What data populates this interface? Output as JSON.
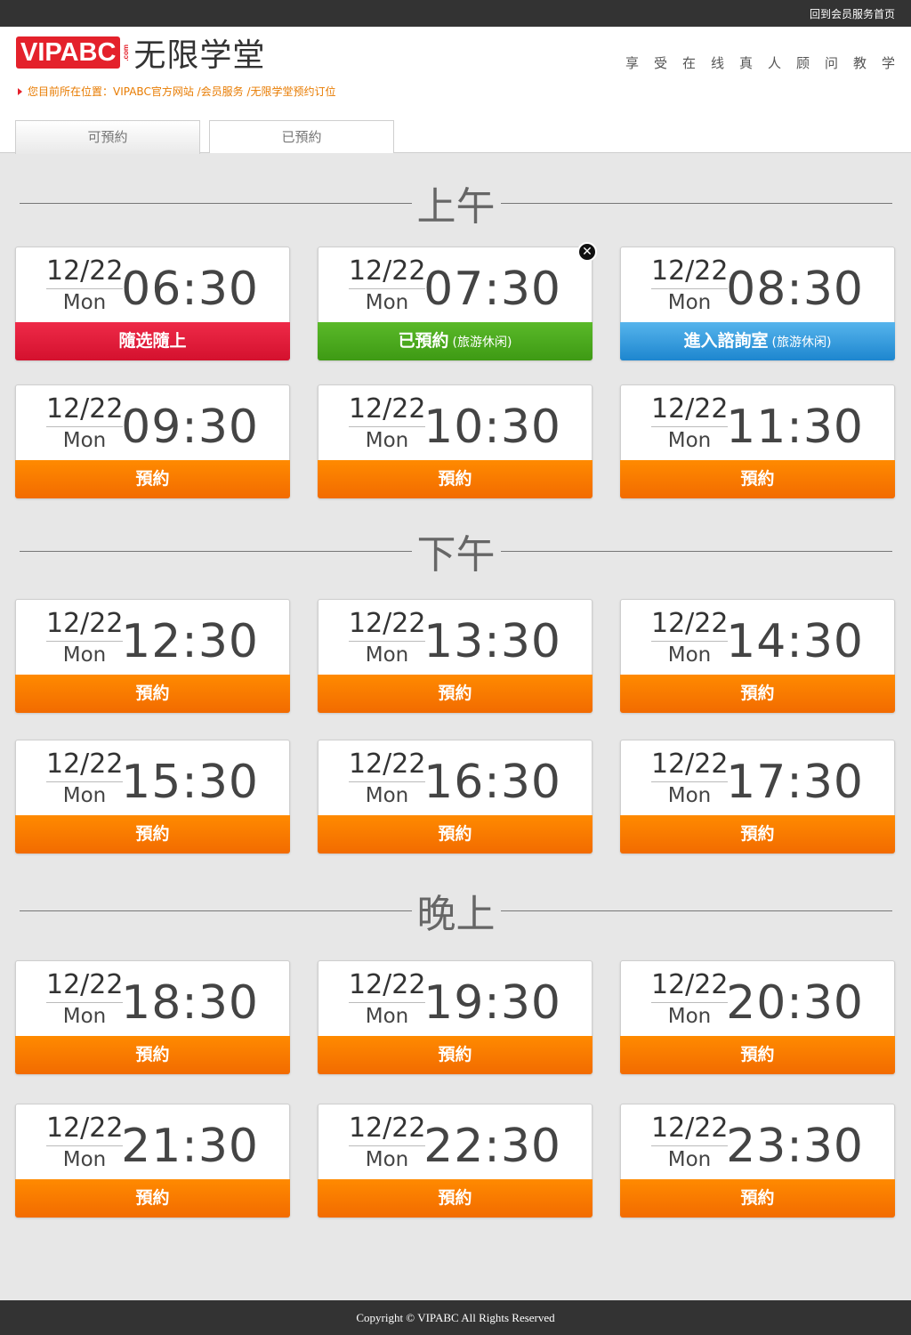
{
  "topbar": {
    "home_link": "回到会员服务首页"
  },
  "header": {
    "logo_main": "VIPABC",
    "logo_com": ".com",
    "logo_text": "无限学堂",
    "slogan": "享受在线真人顾问教学",
    "breadcrumb": "您目前所在位置：VIPABC官方网站 /会员服务 /无限学堂预约订位"
  },
  "tabs": [
    {
      "label": "可預約"
    },
    {
      "label": "已預約"
    }
  ],
  "sections": [
    {
      "label": "上午"
    },
    {
      "label": "下午"
    },
    {
      "label": "晚上"
    }
  ],
  "slots": [
    {
      "date": "12/22",
      "weekday": "Mon",
      "time": "06:30",
      "action": "隨选隨上",
      "note": "",
      "style": "red"
    },
    {
      "date": "12/22",
      "weekday": "Mon",
      "time": "07:30",
      "action": "已預約",
      "note": "(旅游休闲)",
      "style": "green"
    },
    {
      "date": "12/22",
      "weekday": "Mon",
      "time": "08:30",
      "action": "進入諮詢室",
      "note": "(旅游休闲)",
      "style": "blue"
    },
    {
      "date": "12/22",
      "weekday": "Mon",
      "time": "09:30",
      "action": "預約",
      "note": "",
      "style": "orange"
    },
    {
      "date": "12/22",
      "weekday": "Mon",
      "time": "10:30",
      "action": "預約",
      "note": "",
      "style": "orange"
    },
    {
      "date": "12/22",
      "weekday": "Mon",
      "time": "11:30",
      "action": "預約",
      "note": "",
      "style": "orange"
    },
    {
      "date": "12/22",
      "weekday": "Mon",
      "time": "12:30",
      "action": "預約",
      "note": "",
      "style": "orange"
    },
    {
      "date": "12/22",
      "weekday": "Mon",
      "time": "13:30",
      "action": "預約",
      "note": "",
      "style": "orange"
    },
    {
      "date": "12/22",
      "weekday": "Mon",
      "time": "14:30",
      "action": "預約",
      "note": "",
      "style": "orange"
    },
    {
      "date": "12/22",
      "weekday": "Mon",
      "time": "15:30",
      "action": "預約",
      "note": "",
      "style": "orange"
    },
    {
      "date": "12/22",
      "weekday": "Mon",
      "time": "16:30",
      "action": "預約",
      "note": "",
      "style": "orange"
    },
    {
      "date": "12/22",
      "weekday": "Mon",
      "time": "17:30",
      "action": "預約",
      "note": "",
      "style": "orange"
    },
    {
      "date": "12/22",
      "weekday": "Mon",
      "time": "18:30",
      "action": "預約",
      "note": "",
      "style": "orange"
    },
    {
      "date": "12/22",
      "weekday": "Mon",
      "time": "19:30",
      "action": "預約",
      "note": "",
      "style": "orange"
    },
    {
      "date": "12/22",
      "weekday": "Mon",
      "time": "20:30",
      "action": "預約",
      "note": "",
      "style": "orange"
    },
    {
      "date": "12/22",
      "weekday": "Mon",
      "time": "21:30",
      "action": "預約",
      "note": "",
      "style": "orange"
    },
    {
      "date": "12/22",
      "weekday": "Mon",
      "time": "22:30",
      "action": "預約",
      "note": "",
      "style": "orange"
    },
    {
      "date": "12/22",
      "weekday": "Mon",
      "time": "23:30",
      "action": "預約",
      "note": "",
      "style": "orange"
    }
  ],
  "cancel_icon": "close-icon",
  "colors": {
    "orange": "#f57a00",
    "red": "#e4212b",
    "green": "#4aa91d",
    "blue": "#2b95dc",
    "topbar": "#333333"
  },
  "footer": {
    "copyright": "Copyright © VIPABC All Rights Reserved"
  }
}
